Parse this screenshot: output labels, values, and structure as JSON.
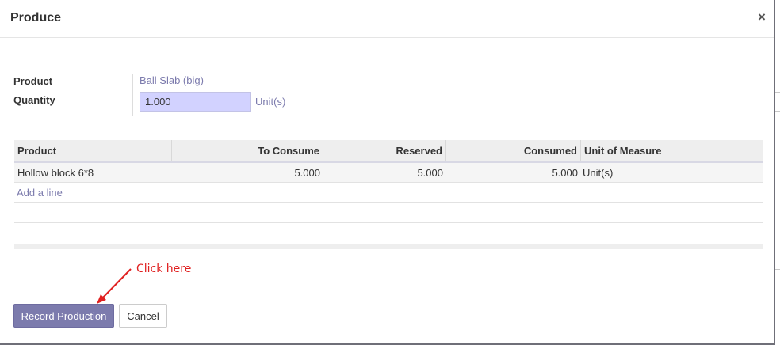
{
  "dialog": {
    "title": "Produce",
    "close_symbol": "×"
  },
  "form": {
    "product_label": "Product",
    "product_value": "Ball Slab (big)",
    "quantity_label": "Quantity",
    "quantity_value": "1.000",
    "quantity_unit": "Unit(s)"
  },
  "table": {
    "headers": [
      "Product",
      "To Consume",
      "Reserved",
      "Consumed",
      "Unit of Measure"
    ],
    "rows": [
      {
        "product": "Hollow block 6*8",
        "to_consume": "5.000",
        "reserved": "5.000",
        "consumed": "5.000",
        "uom": "Unit(s)"
      }
    ],
    "add_line_label": "Add a line"
  },
  "annotation": {
    "text": "Click here",
    "color": "#e02020"
  },
  "footer": {
    "record_label": "Record Production",
    "cancel_label": "Cancel"
  },
  "colors": {
    "primary": "#7c7bad",
    "input_highlight": "#d2d2ff"
  },
  "icons": {
    "close": "close-icon",
    "arrow": "arrow-icon"
  }
}
